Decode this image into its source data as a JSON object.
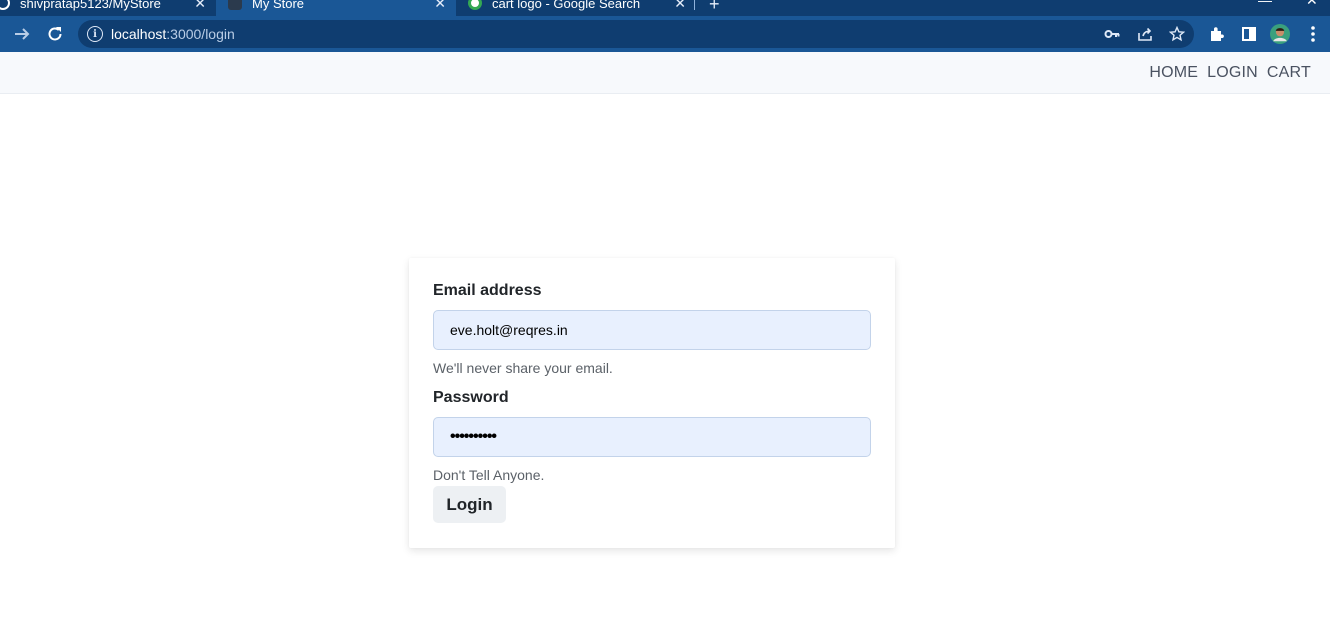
{
  "browser": {
    "tabs": [
      {
        "title": "shivpratap5123/MyStore",
        "active": false
      },
      {
        "title": "My Store",
        "active": true
      },
      {
        "title": "cart logo - Google Search",
        "active": false
      }
    ],
    "url_host": "localhost",
    "url_path": ":3000/login",
    "icons": [
      "forward-icon",
      "reload-icon",
      "info-icon",
      "key-icon",
      "share-icon",
      "star-icon",
      "extensions-icon",
      "sidepanel-icon",
      "profile-avatar",
      "menu-icon"
    ],
    "colors": {
      "frame": "#0f3d70",
      "toolbar": "#1a5796"
    }
  },
  "nav": {
    "links": [
      "HOME",
      "LOGIN",
      "CART"
    ]
  },
  "form": {
    "email_label": "Email address",
    "email_value": "eve.holt@reqres.in",
    "email_help": "We'll never share your email.",
    "password_label": "Password",
    "password_value": "••••••••••",
    "password_help": "Don't Tell Anyone.",
    "submit_label": "Login"
  }
}
